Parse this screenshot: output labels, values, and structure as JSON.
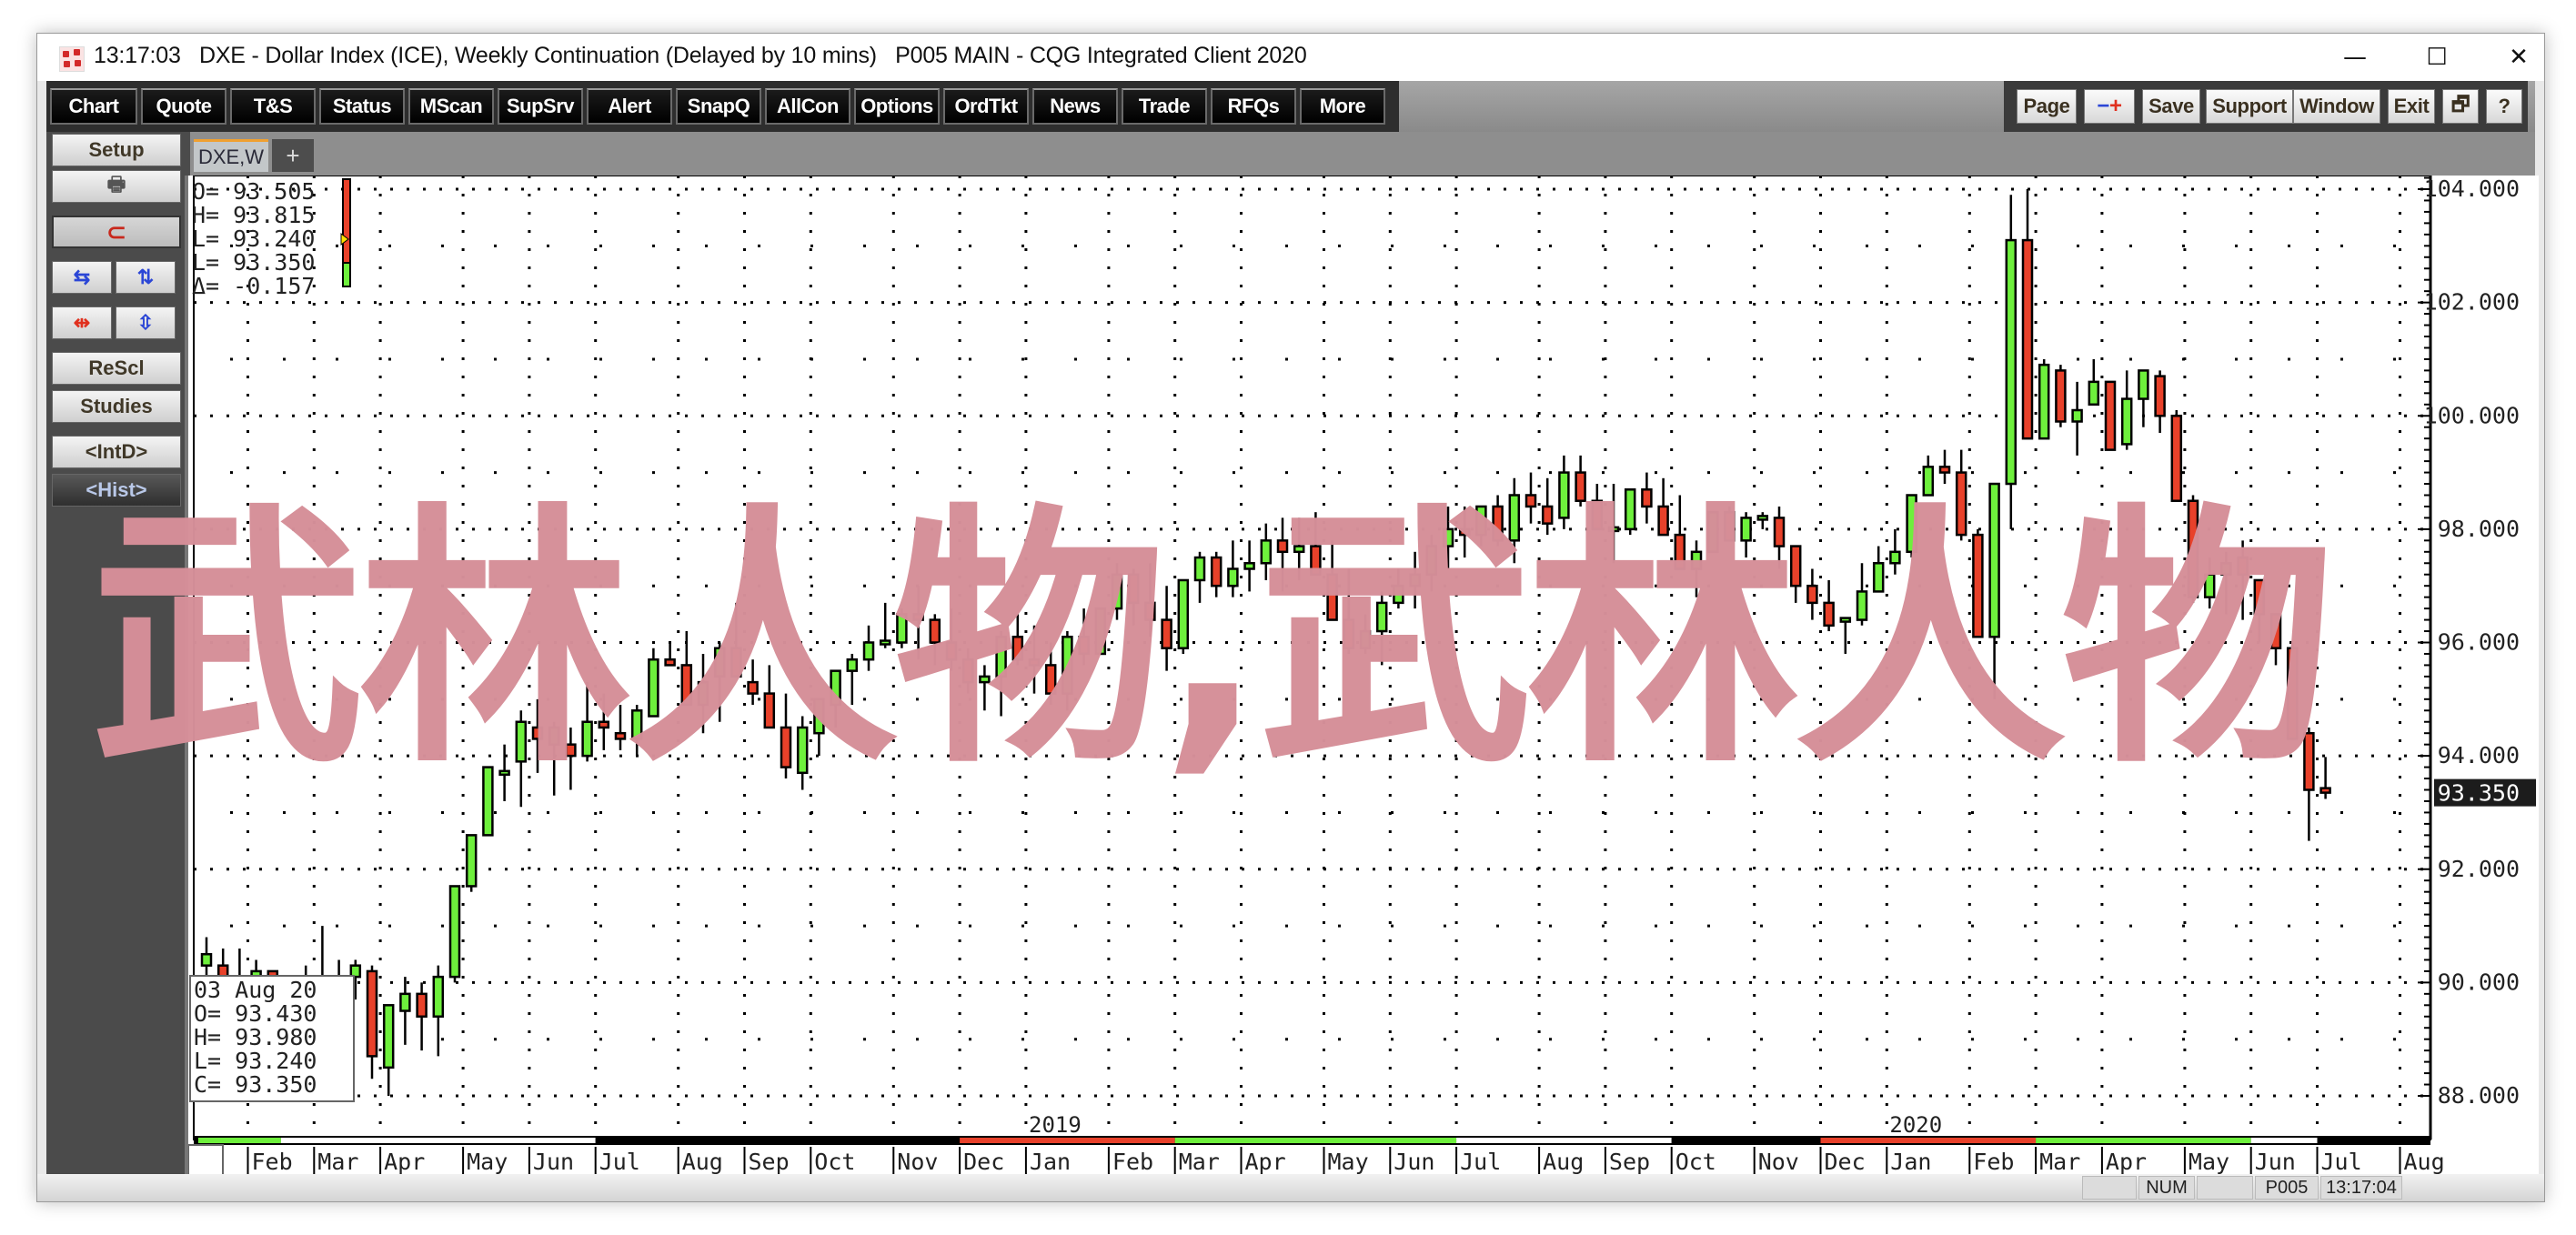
{
  "window": {
    "time": "13:17:03",
    "title": "DXE - Dollar Index (ICE), Weekly Continuation (Delayed by 10 mins)   P005 MAIN - CQG Integrated Client 2020",
    "controls": {
      "minimize": "—",
      "maximize": "☐",
      "close": "✕"
    }
  },
  "toolbar": {
    "left_buttons": [
      "Chart",
      "Quote",
      "T&S",
      "Status",
      "MScan",
      "SupSrv",
      "Alert",
      "SnapQ",
      "AllCon",
      "Options",
      "OrdTkt",
      "News",
      "Trade",
      "RFQs",
      "More"
    ],
    "right_buttons": {
      "page": "Page",
      "zoom": "−+",
      "save": "Save",
      "support": "Support",
      "window": "Window",
      "exit": "Exit",
      "restore": "🗗",
      "help": "?"
    }
  },
  "left_panel": {
    "setup": "Setup",
    "print_icon": "🖶",
    "magnet_icon": "⊂",
    "rescale": "ReScl",
    "studies": "Studies",
    "intd": "<IntD>",
    "hist": "<Hist>"
  },
  "tabs": {
    "active": "DXE,W",
    "add": "+"
  },
  "quote_box": {
    "lines": [
      "O=  93.505",
      "H=  93.815",
      "L=  93.240",
      "L=  93.350",
      "Δ=  -0.157"
    ],
    "bar_colors": {
      "up": "#6ee83f",
      "down": "#e8412a"
    }
  },
  "cursor_box": {
    "date": "03  Aug  20",
    "lines": [
      "O=    93.430",
      "H=    93.980",
      "L=    93.240",
      "C=    93.350"
    ]
  },
  "status_bar": {
    "num": "NUM",
    "page": "P005",
    "time": "13:17:04"
  },
  "watermark": "武林人物,武林人物",
  "colors": {
    "up": "#6ef03c",
    "down": "#e8412a",
    "last_price_bg": "#1c1c1c",
    "watermark": "#d68f99"
  },
  "chart_data": {
    "type": "candlestick",
    "title": "DXE - Dollar Index (ICE), Weekly Continuation",
    "xlabel": "",
    "ylabel": "",
    "ylim": [
      88,
      104.5
    ],
    "y_ticks": [
      "104.000",
      "102.000",
      "100.000",
      "98.000",
      "96.000",
      "94.000",
      "92.000",
      "90.000",
      "88.000"
    ],
    "y_tick_values": [
      104,
      102,
      100,
      98,
      96,
      94,
      92,
      90,
      88
    ],
    "last_price": "93.350",
    "last_price_value": 93.35,
    "x_month_labels": [
      "Feb",
      "Mar",
      "Apr",
      "May",
      "Jun",
      "Jul",
      "Aug",
      "Sep",
      "Oct",
      "Nov",
      "Dec",
      "Jan",
      "Feb",
      "Mar",
      "Apr",
      "May",
      "Jun",
      "Jul",
      "Aug",
      "Sep",
      "Oct",
      "Nov",
      "Dec",
      "Jan",
      "Feb",
      "Mar",
      "Apr",
      "May",
      "Jun",
      "Jul",
      "Aug"
    ],
    "x_month_week_index": [
      3,
      7,
      11,
      16,
      20,
      24,
      29,
      33,
      37,
      42,
      46,
      50,
      55,
      59,
      63,
      68,
      72,
      76,
      81,
      85,
      89,
      94,
      98,
      102,
      107,
      111,
      115,
      120,
      124,
      128,
      133
    ],
    "year_labels": [
      {
        "label": "2019",
        "week_index": 50
      },
      {
        "label": "2020",
        "week_index": 102
      }
    ],
    "grid": true,
    "candles_ohlc": [
      [
        90.3,
        90.8,
        89.9,
        90.5
      ],
      [
        90.3,
        90.6,
        89.6,
        89.8
      ],
      [
        89.9,
        90.6,
        89.3,
        89.6
      ],
      [
        89.6,
        90.4,
        89.2,
        90.2
      ],
      [
        90.2,
        90.2,
        89.5,
        89.8
      ],
      [
        89.6,
        90.1,
        89.0,
        89.6
      ],
      [
        89.9,
        90.3,
        89.4,
        89.9
      ],
      [
        89.8,
        91.0,
        89.4,
        89.9
      ],
      [
        89.8,
        90.4,
        89.2,
        90.1
      ],
      [
        90.1,
        90.4,
        89.7,
        90.3
      ],
      [
        90.2,
        90.3,
        88.3,
        88.7
      ],
      [
        88.5,
        89.4,
        88.0,
        89.6
      ],
      [
        89.5,
        90.1,
        88.9,
        89.8
      ],
      [
        89.8,
        90.0,
        88.8,
        89.4
      ],
      [
        89.4,
        90.3,
        88.7,
        90.1
      ],
      [
        90.1,
        91.6,
        90.0,
        91.7
      ],
      [
        91.7,
        92.6,
        91.6,
        92.6
      ],
      [
        92.6,
        93.6,
        92.6,
        93.8
      ],
      [
        93.7,
        94.2,
        93.2,
        93.7
      ],
      [
        93.9,
        94.8,
        93.1,
        94.6
      ],
      [
        94.5,
        95.0,
        93.7,
        94.3
      ],
      [
        94.2,
        94.6,
        93.3,
        94.5
      ],
      [
        94.2,
        94.5,
        93.4,
        94.0
      ],
      [
        94.0,
        95.3,
        93.9,
        94.6
      ],
      [
        94.6,
        95.1,
        94.1,
        94.5
      ],
      [
        94.4,
        94.9,
        94.1,
        94.3
      ],
      [
        94.3,
        94.9,
        94.0,
        94.8
      ],
      [
        94.7,
        95.9,
        94.7,
        95.7
      ],
      [
        95.7,
        96.0,
        95.6,
        95.6
      ],
      [
        95.6,
        96.2,
        95.0,
        94.9
      ],
      [
        94.9,
        95.8,
        94.4,
        95.3
      ],
      [
        95.4,
        96.0,
        94.6,
        95.9
      ],
      [
        95.9,
        96.7,
        95.5,
        95.4
      ],
      [
        95.3,
        95.7,
        94.9,
        95.1
      ],
      [
        95.1,
        95.6,
        94.6,
        94.5
      ],
      [
        94.5,
        95.1,
        93.6,
        93.8
      ],
      [
        93.7,
        94.7,
        93.4,
        94.5
      ],
      [
        94.4,
        95.0,
        94.0,
        95.0
      ],
      [
        94.9,
        95.5,
        94.5,
        95.5
      ],
      [
        95.5,
        95.8,
        94.9,
        95.7
      ],
      [
        95.7,
        96.3,
        95.5,
        96.0
      ],
      [
        96.0,
        96.7,
        95.9,
        96.0
      ],
      [
        96.0,
        96.6,
        95.9,
        96.5
      ],
      [
        96.5,
        97.0,
        95.7,
        96.4
      ],
      [
        96.4,
        96.5,
        95.6,
        96.0
      ],
      [
        96.0,
        96.6,
        95.5,
        95.7
      ],
      [
        95.7,
        95.9,
        95.1,
        95.3
      ],
      [
        95.3,
        95.6,
        94.8,
        95.4
      ],
      [
        95.4,
        96.2,
        94.7,
        96.1
      ],
      [
        96.1,
        96.5,
        95.6,
        95.7
      ],
      [
        95.7,
        96.3,
        95.1,
        95.6
      ],
      [
        95.6,
        96.0,
        94.9,
        95.1
      ],
      [
        95.1,
        96.2,
        94.8,
        96.1
      ],
      [
        96.1,
        96.6,
        95.6,
        95.8
      ],
      [
        95.8,
        96.6,
        95.8,
        96.6
      ],
      [
        96.6,
        97.4,
        96.4,
        97.2
      ],
      [
        97.2,
        97.3,
        96.3,
        96.7
      ],
      [
        96.7,
        97.4,
        96.1,
        96.4
      ],
      [
        96.4,
        97.0,
        95.5,
        95.9
      ],
      [
        95.9,
        97.1,
        95.8,
        97.1
      ],
      [
        97.1,
        97.6,
        96.7,
        97.5
      ],
      [
        97.5,
        97.6,
        96.8,
        97.0
      ],
      [
        97.0,
        97.8,
        96.8,
        97.3
      ],
      [
        97.3,
        97.8,
        96.9,
        97.4
      ],
      [
        97.4,
        98.1,
        97.1,
        97.8
      ],
      [
        97.8,
        98.2,
        96.9,
        97.6
      ],
      [
        97.6,
        98.2,
        97.1,
        97.7
      ],
      [
        97.7,
        98.3,
        97.3,
        97.2
      ],
      [
        97.2,
        97.8,
        96.4,
        96.4
      ],
      [
        96.4,
        97.3,
        95.8,
        95.9
      ],
      [
        95.9,
        96.5,
        95.8,
        96.2
      ],
      [
        96.2,
        96.9,
        95.6,
        96.7
      ],
      [
        96.7,
        97.3,
        96.6,
        97.0
      ],
      [
        97.0,
        97.6,
        96.6,
        97.2
      ],
      [
        97.2,
        97.9,
        96.9,
        97.7
      ],
      [
        97.7,
        98.4,
        97.3,
        98.0
      ],
      [
        98.0,
        98.4,
        97.5,
        97.9
      ],
      [
        97.9,
        98.3,
        97.7,
        98.4
      ],
      [
        98.4,
        98.6,
        97.7,
        97.8
      ],
      [
        97.8,
        98.9,
        97.4,
        98.6
      ],
      [
        98.6,
        99.0,
        98.1,
        98.4
      ],
      [
        98.4,
        98.9,
        97.9,
        98.1
      ],
      [
        98.2,
        99.3,
        98.0,
        99.0
      ],
      [
        99.0,
        99.3,
        98.4,
        98.5
      ],
      [
        98.5,
        98.8,
        98.0,
        98.0
      ],
      [
        98.0,
        98.8,
        97.4,
        98.0
      ],
      [
        98.0,
        98.7,
        97.9,
        98.7
      ],
      [
        98.7,
        99.0,
        98.1,
        98.4
      ],
      [
        98.4,
        98.9,
        98.1,
        97.9
      ],
      [
        97.9,
        98.6,
        97.4,
        97.3
      ],
      [
        97.3,
        97.8,
        96.8,
        97.6
      ],
      [
        97.6,
        98.3,
        97.7,
        98.3
      ],
      [
        98.3,
        98.4,
        97.8,
        97.8
      ],
      [
        97.8,
        98.3,
        97.5,
        98.2
      ],
      [
        98.2,
        98.3,
        98.0,
        98.2
      ],
      [
        98.2,
        98.4,
        97.3,
        97.7
      ],
      [
        97.7,
        97.7,
        96.7,
        97.0
      ],
      [
        97.0,
        97.3,
        96.4,
        96.7
      ],
      [
        96.7,
        97.1,
        96.2,
        96.3
      ],
      [
        96.4,
        96.4,
        95.8,
        96.4
      ],
      [
        96.4,
        97.4,
        96.3,
        96.9
      ],
      [
        96.9,
        97.7,
        97.1,
        97.4
      ],
      [
        97.4,
        98.0,
        97.2,
        97.6
      ],
      [
        97.6,
        98.6,
        97.5,
        98.6
      ],
      [
        98.6,
        99.3,
        98.6,
        99.1
      ],
      [
        99.1,
        99.4,
        98.8,
        99.0
      ],
      [
        99.0,
        99.4,
        97.8,
        97.9
      ],
      [
        97.9,
        98.0,
        96.2,
        96.1
      ],
      [
        96.1,
        98.5,
        95.0,
        98.8
      ],
      [
        98.8,
        103.9,
        98.0,
        103.1
      ],
      [
        103.1,
        104.0,
        99.7,
        99.6
      ],
      [
        99.6,
        101.0,
        99.6,
        100.9
      ],
      [
        100.8,
        100.9,
        99.8,
        99.9
      ],
      [
        99.9,
        100.6,
        99.3,
        100.1
      ],
      [
        100.2,
        101.0,
        100.2,
        100.6
      ],
      [
        100.6,
        100.6,
        99.4,
        99.4
      ],
      [
        99.5,
        100.8,
        99.4,
        100.3
      ],
      [
        100.3,
        100.7,
        99.8,
        100.8
      ],
      [
        100.7,
        100.8,
        99.7,
        100.0
      ],
      [
        100.0,
        100.1,
        98.6,
        98.5
      ],
      [
        98.5,
        98.6,
        96.7,
        96.8
      ],
      [
        96.8,
        97.5,
        96.6,
        97.2
      ],
      [
        97.2,
        97.6,
        96.5,
        97.4
      ],
      [
        97.5,
        97.8,
        96.4,
        97.2
      ],
      [
        97.1,
        97.1,
        96.0,
        96.5
      ],
      [
        96.5,
        96.5,
        95.6,
        95.9
      ],
      [
        95.9,
        96.0,
        94.6,
        94.3
      ],
      [
        94.4,
        94.5,
        92.5,
        93.4
      ],
      [
        93.43,
        93.98,
        93.24,
        93.35
      ]
    ]
  }
}
